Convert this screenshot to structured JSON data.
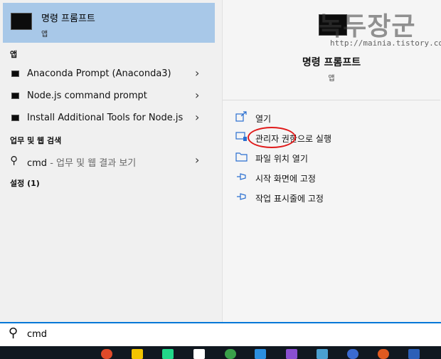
{
  "best_match": {
    "title": "명령 프롬프트",
    "subtitle": "앱"
  },
  "apps_section": "앱",
  "apps": [
    {
      "label": "Anaconda Prompt (Anaconda3)"
    },
    {
      "label": "Node.js command prompt"
    },
    {
      "label": "Install Additional Tools for Node.js"
    }
  ],
  "web_section": "업무 및 웹 검색",
  "web_item": {
    "query": "cmd",
    "suffix": " - 업무 및 웹 결과 보기"
  },
  "settings_section": "설정 (1)",
  "detail": {
    "title": "명령 프롬프트",
    "subtitle": "앱",
    "actions": [
      "열기",
      "관리자 권한으로 실행",
      "파일 위치 열기",
      "시작 화면에 고정",
      "작업 표시줄에 고정"
    ]
  },
  "watermark": {
    "main": "녹두장군",
    "sub": "http://mainia.tistory.com"
  },
  "search": {
    "value": "cmd"
  },
  "colors": {
    "selected": "#a8c8e8",
    "accent": "#0078d7",
    "highlight_circle": "#e01a1a",
    "action_icon": "#2a6fd0"
  },
  "icons": [
    "terminal-app-icon",
    "search-icon",
    "chevron-right-icon",
    "open-icon",
    "run-as-admin-icon",
    "folder-icon",
    "pin-icon"
  ]
}
